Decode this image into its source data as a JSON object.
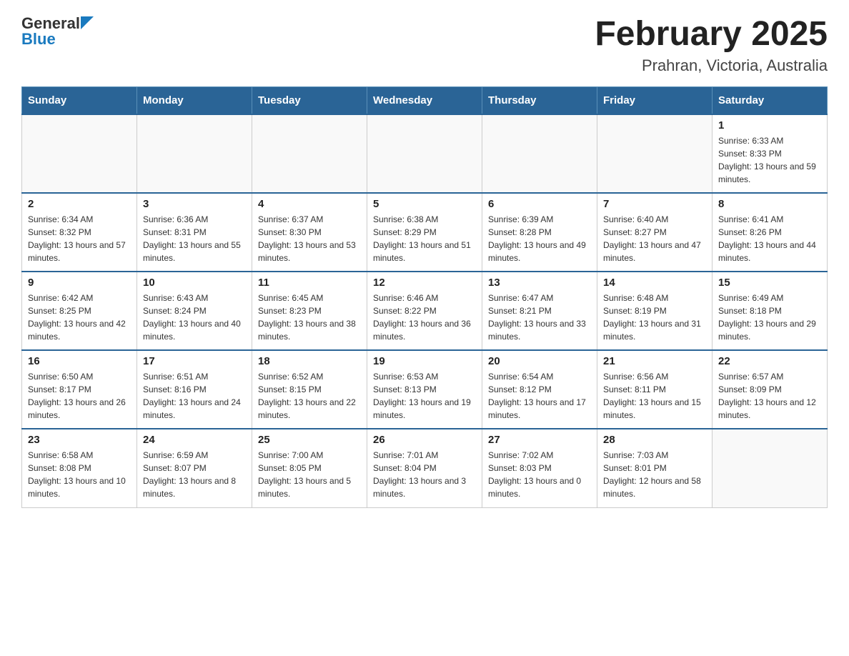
{
  "header": {
    "logo_general": "General",
    "logo_blue": "Blue",
    "title": "February 2025",
    "subtitle": "Prahran, Victoria, Australia"
  },
  "days_of_week": [
    "Sunday",
    "Monday",
    "Tuesday",
    "Wednesday",
    "Thursday",
    "Friday",
    "Saturday"
  ],
  "weeks": [
    [
      {
        "day": "",
        "sunrise": "",
        "sunset": "",
        "daylight": ""
      },
      {
        "day": "",
        "sunrise": "",
        "sunset": "",
        "daylight": ""
      },
      {
        "day": "",
        "sunrise": "",
        "sunset": "",
        "daylight": ""
      },
      {
        "day": "",
        "sunrise": "",
        "sunset": "",
        "daylight": ""
      },
      {
        "day": "",
        "sunrise": "",
        "sunset": "",
        "daylight": ""
      },
      {
        "day": "",
        "sunrise": "",
        "sunset": "",
        "daylight": ""
      },
      {
        "day": "1",
        "sunrise": "Sunrise: 6:33 AM",
        "sunset": "Sunset: 8:33 PM",
        "daylight": "Daylight: 13 hours and 59 minutes."
      }
    ],
    [
      {
        "day": "2",
        "sunrise": "Sunrise: 6:34 AM",
        "sunset": "Sunset: 8:32 PM",
        "daylight": "Daylight: 13 hours and 57 minutes."
      },
      {
        "day": "3",
        "sunrise": "Sunrise: 6:36 AM",
        "sunset": "Sunset: 8:31 PM",
        "daylight": "Daylight: 13 hours and 55 minutes."
      },
      {
        "day": "4",
        "sunrise": "Sunrise: 6:37 AM",
        "sunset": "Sunset: 8:30 PM",
        "daylight": "Daylight: 13 hours and 53 minutes."
      },
      {
        "day": "5",
        "sunrise": "Sunrise: 6:38 AM",
        "sunset": "Sunset: 8:29 PM",
        "daylight": "Daylight: 13 hours and 51 minutes."
      },
      {
        "day": "6",
        "sunrise": "Sunrise: 6:39 AM",
        "sunset": "Sunset: 8:28 PM",
        "daylight": "Daylight: 13 hours and 49 minutes."
      },
      {
        "day": "7",
        "sunrise": "Sunrise: 6:40 AM",
        "sunset": "Sunset: 8:27 PM",
        "daylight": "Daylight: 13 hours and 47 minutes."
      },
      {
        "day": "8",
        "sunrise": "Sunrise: 6:41 AM",
        "sunset": "Sunset: 8:26 PM",
        "daylight": "Daylight: 13 hours and 44 minutes."
      }
    ],
    [
      {
        "day": "9",
        "sunrise": "Sunrise: 6:42 AM",
        "sunset": "Sunset: 8:25 PM",
        "daylight": "Daylight: 13 hours and 42 minutes."
      },
      {
        "day": "10",
        "sunrise": "Sunrise: 6:43 AM",
        "sunset": "Sunset: 8:24 PM",
        "daylight": "Daylight: 13 hours and 40 minutes."
      },
      {
        "day": "11",
        "sunrise": "Sunrise: 6:45 AM",
        "sunset": "Sunset: 8:23 PM",
        "daylight": "Daylight: 13 hours and 38 minutes."
      },
      {
        "day": "12",
        "sunrise": "Sunrise: 6:46 AM",
        "sunset": "Sunset: 8:22 PM",
        "daylight": "Daylight: 13 hours and 36 minutes."
      },
      {
        "day": "13",
        "sunrise": "Sunrise: 6:47 AM",
        "sunset": "Sunset: 8:21 PM",
        "daylight": "Daylight: 13 hours and 33 minutes."
      },
      {
        "day": "14",
        "sunrise": "Sunrise: 6:48 AM",
        "sunset": "Sunset: 8:19 PM",
        "daylight": "Daylight: 13 hours and 31 minutes."
      },
      {
        "day": "15",
        "sunrise": "Sunrise: 6:49 AM",
        "sunset": "Sunset: 8:18 PM",
        "daylight": "Daylight: 13 hours and 29 minutes."
      }
    ],
    [
      {
        "day": "16",
        "sunrise": "Sunrise: 6:50 AM",
        "sunset": "Sunset: 8:17 PM",
        "daylight": "Daylight: 13 hours and 26 minutes."
      },
      {
        "day": "17",
        "sunrise": "Sunrise: 6:51 AM",
        "sunset": "Sunset: 8:16 PM",
        "daylight": "Daylight: 13 hours and 24 minutes."
      },
      {
        "day": "18",
        "sunrise": "Sunrise: 6:52 AM",
        "sunset": "Sunset: 8:15 PM",
        "daylight": "Daylight: 13 hours and 22 minutes."
      },
      {
        "day": "19",
        "sunrise": "Sunrise: 6:53 AM",
        "sunset": "Sunset: 8:13 PM",
        "daylight": "Daylight: 13 hours and 19 minutes."
      },
      {
        "day": "20",
        "sunrise": "Sunrise: 6:54 AM",
        "sunset": "Sunset: 8:12 PM",
        "daylight": "Daylight: 13 hours and 17 minutes."
      },
      {
        "day": "21",
        "sunrise": "Sunrise: 6:56 AM",
        "sunset": "Sunset: 8:11 PM",
        "daylight": "Daylight: 13 hours and 15 minutes."
      },
      {
        "day": "22",
        "sunrise": "Sunrise: 6:57 AM",
        "sunset": "Sunset: 8:09 PM",
        "daylight": "Daylight: 13 hours and 12 minutes."
      }
    ],
    [
      {
        "day": "23",
        "sunrise": "Sunrise: 6:58 AM",
        "sunset": "Sunset: 8:08 PM",
        "daylight": "Daylight: 13 hours and 10 minutes."
      },
      {
        "day": "24",
        "sunrise": "Sunrise: 6:59 AM",
        "sunset": "Sunset: 8:07 PM",
        "daylight": "Daylight: 13 hours and 8 minutes."
      },
      {
        "day": "25",
        "sunrise": "Sunrise: 7:00 AM",
        "sunset": "Sunset: 8:05 PM",
        "daylight": "Daylight: 13 hours and 5 minutes."
      },
      {
        "day": "26",
        "sunrise": "Sunrise: 7:01 AM",
        "sunset": "Sunset: 8:04 PM",
        "daylight": "Daylight: 13 hours and 3 minutes."
      },
      {
        "day": "27",
        "sunrise": "Sunrise: 7:02 AM",
        "sunset": "Sunset: 8:03 PM",
        "daylight": "Daylight: 13 hours and 0 minutes."
      },
      {
        "day": "28",
        "sunrise": "Sunrise: 7:03 AM",
        "sunset": "Sunset: 8:01 PM",
        "daylight": "Daylight: 12 hours and 58 minutes."
      },
      {
        "day": "",
        "sunrise": "",
        "sunset": "",
        "daylight": ""
      }
    ]
  ]
}
